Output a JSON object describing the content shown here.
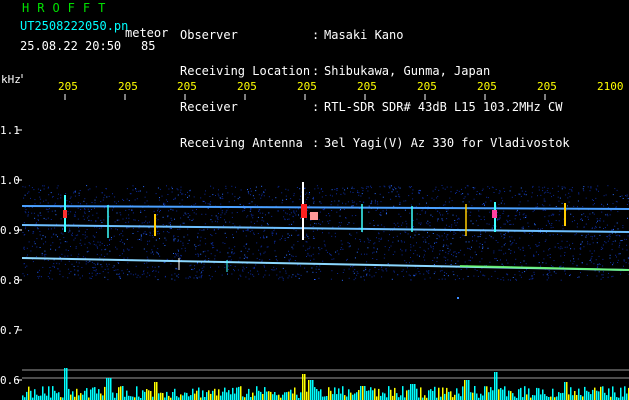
{
  "header": {
    "app_title": "HROFFT",
    "filename": "UT2508222050.pn",
    "type_label": "meteor",
    "timestamp": "25.08.22 20:50",
    "count": "85",
    "meta": [
      {
        "key": "Observer",
        "value": "Masaki Kano"
      },
      {
        "key": "Receiving Location",
        "value": "Shibukawa, Gunma, Japan"
      },
      {
        "key": "Receiver",
        "value": "RTL-SDR SDR# 43dB L15 103.2MHz CW"
      },
      {
        "key": "Receiving Antenna",
        "value": "3el Yagi(V) Az 330 for Vladivostok"
      }
    ]
  },
  "axes": {
    "unit": "kHz",
    "x_ticks": [
      "205",
      "205",
      "205",
      "205",
      "205",
      "205",
      "205",
      "205",
      "205",
      "2100"
    ],
    "y_ticks": [
      "1.1",
      "1.0",
      "0.9",
      "0.8",
      "0.7",
      "0.6"
    ]
  },
  "colors": {
    "accent_green": "#00e000",
    "tick_yellow": "#ffff00",
    "bar_yellow": "#ffff00",
    "bar_cyan": "#00ffff"
  }
}
